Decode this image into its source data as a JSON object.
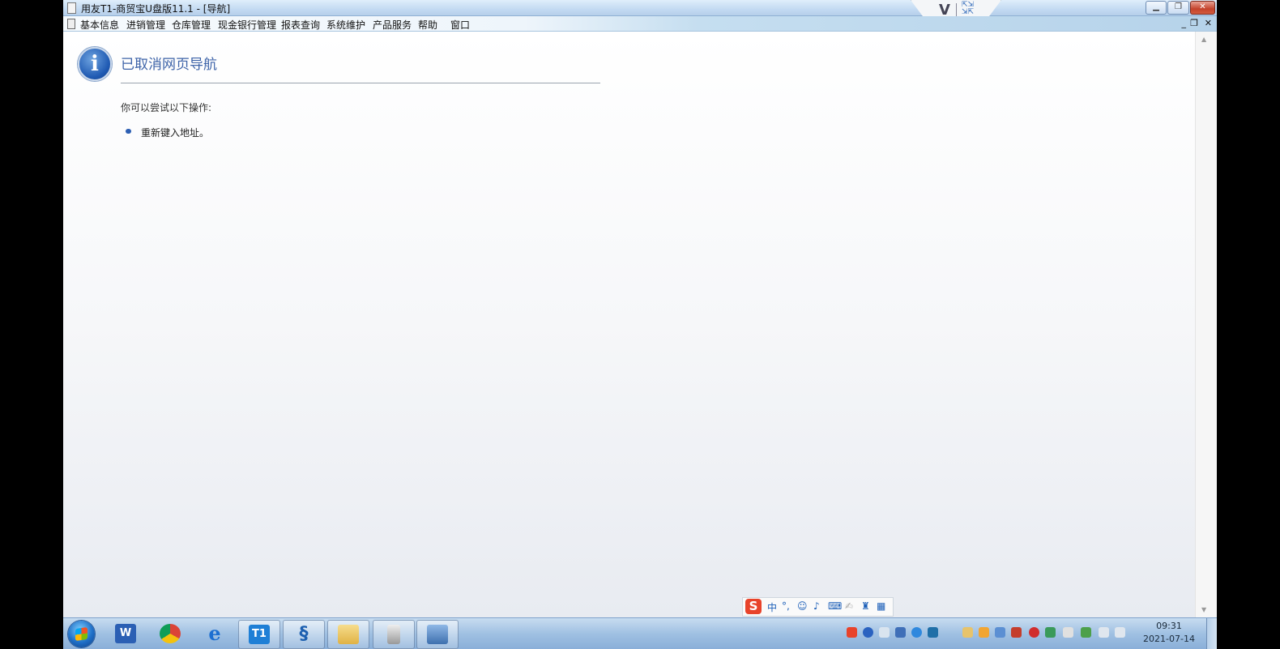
{
  "window": {
    "title": "用友T1-商贸宝U盘版11.1 - [导航]",
    "minimize_icon": "minimize-icon",
    "restore_icon": "restore-icon",
    "close_icon": "close-icon"
  },
  "menu": {
    "items": [
      "基本信息",
      "进销管理",
      "仓库管理",
      "现金银行管理",
      "报表查询",
      "系统维护",
      "产品服务",
      "帮助",
      "窗口"
    ],
    "mdi_controls": [
      "_",
      "❐",
      "✕"
    ]
  },
  "page": {
    "heading": "已取消网页导航",
    "subtitle": "你可以尝试以下操作:",
    "actions": [
      "重新键入地址。"
    ]
  },
  "ime_bar": {
    "logo": "S",
    "mode": "中",
    "icons": [
      "punctuation-icon",
      "emoji-icon",
      "microphone-icon",
      "keyboard-icon",
      "handwriting-icon",
      "skin-shirt-icon",
      "toolbox-icon"
    ]
  },
  "taskbar": {
    "apps": [
      "word-icon",
      "chrome-icon",
      "ie-icon",
      "t1-icon",
      "sync-icon",
      "explorer-icon",
      "usb-drive-icon",
      "remote-desktop-icon"
    ],
    "t1_label": "T1",
    "word_label": "W",
    "clock": {
      "time": "09:31",
      "date": "2021-07-14"
    }
  },
  "colors": {
    "heading": "#3d63a8",
    "bullet": "#2d5fb3",
    "taskbar": "#9fc0e2"
  }
}
